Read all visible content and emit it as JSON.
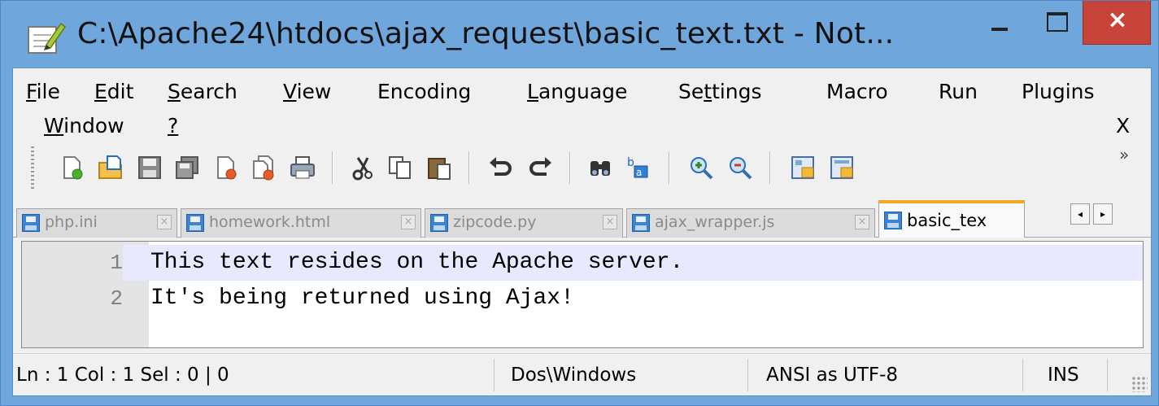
{
  "window": {
    "title": "C:\\Apache24\\htdocs\\ajax_request\\basic_text.txt - Not...",
    "close_glyph": "×",
    "accent_color": "#6fa7dc",
    "close_color": "#c8443a"
  },
  "menu": {
    "row1": [
      {
        "pre": "",
        "key": "F",
        "post": "ile"
      },
      {
        "pre": "",
        "key": "E",
        "post": "dit"
      },
      {
        "pre": "",
        "key": "S",
        "post": "earch"
      },
      {
        "pre": "",
        "key": "V",
        "post": "iew"
      },
      {
        "pre": "Encoding",
        "key": "",
        "post": ""
      },
      {
        "pre": "",
        "key": "L",
        "post": "anguage"
      },
      {
        "pre": "Se",
        "key": "t",
        "post": "tings"
      },
      {
        "pre": "Macro",
        "key": "",
        "post": ""
      },
      {
        "pre": "Run",
        "key": "",
        "post": ""
      },
      {
        "pre": "Plugins",
        "key": "",
        "post": ""
      }
    ],
    "row2": [
      {
        "pre": "",
        "key": "W",
        "post": "indow"
      },
      {
        "pre": "",
        "key": "?",
        "post": ""
      }
    ],
    "close_doc": "X"
  },
  "toolbar": {
    "icons": [
      "new-file-icon",
      "open-file-icon",
      "save-icon",
      "save-all-icon",
      "close-icon",
      "close-all-icon",
      "print-icon",
      "cut-icon",
      "copy-icon",
      "paste-icon",
      "undo-icon",
      "redo-icon",
      "find-icon",
      "replace-icon",
      "zoom-in-icon",
      "zoom-out-icon",
      "sync-vertical-icon",
      "sync-horizontal-icon"
    ],
    "overflow": "»"
  },
  "tabs": [
    {
      "label": "php.ini",
      "active": false
    },
    {
      "label": "homework.html",
      "active": false
    },
    {
      "label": "zipcode.py",
      "active": false
    },
    {
      "label": "ajax_wrapper.js",
      "active": false
    },
    {
      "label": "basic_tex",
      "active": true
    }
  ],
  "tab_close_glyph": "×",
  "tab_scroll": {
    "left": "◂",
    "right": "▸"
  },
  "editor": {
    "lines": [
      {
        "num": "1",
        "text": "This text resides on the Apache server."
      },
      {
        "num": "2",
        "text": "It's being returned using Ajax!"
      }
    ]
  },
  "status": {
    "position": "Ln : 1    Col : 1    Sel : 0 | 0",
    "eol": "Dos\\Windows",
    "encoding": "ANSI as UTF-8",
    "mode": "INS"
  }
}
